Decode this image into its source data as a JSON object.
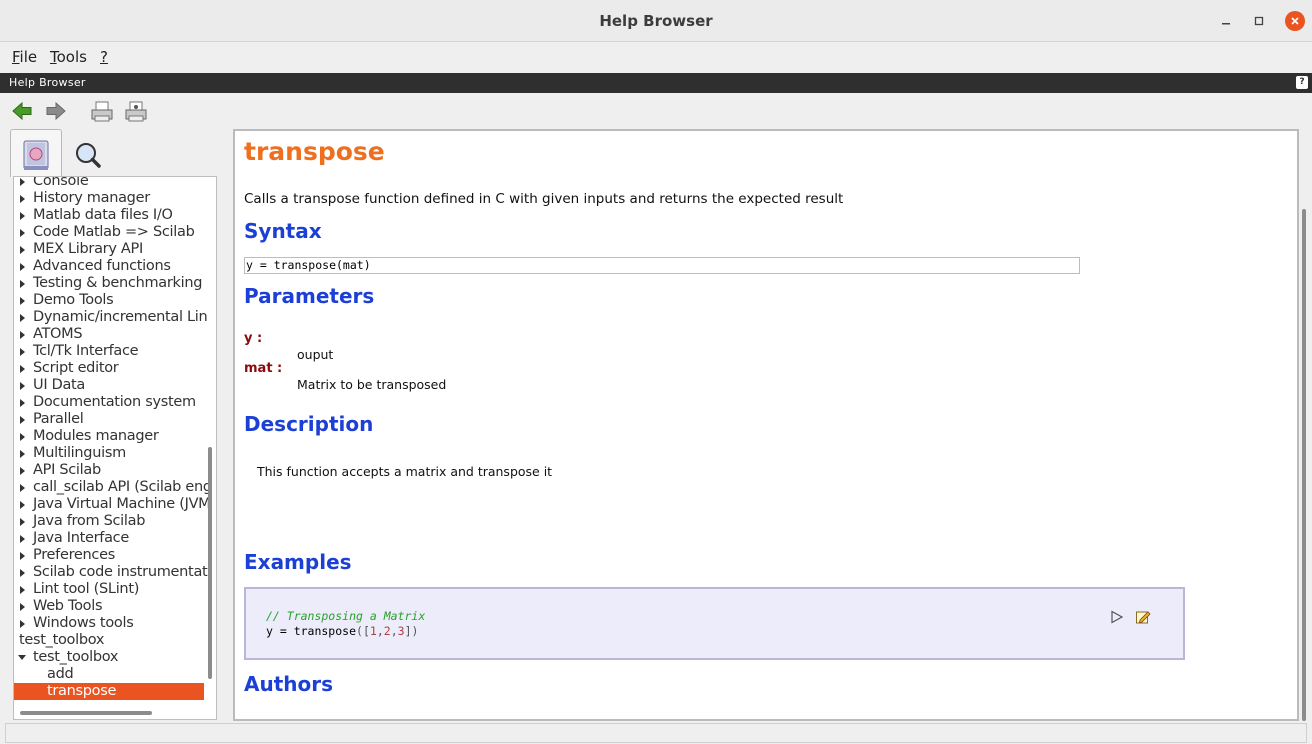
{
  "window": {
    "title": "Help Browser",
    "minimize_glyph": "▁",
    "maximize_glyph": "▫",
    "close_glyph": "✕"
  },
  "menu": [
    {
      "underline": "F",
      "rest": "ile"
    },
    {
      "underline": "T",
      "rest": "ools"
    },
    {
      "underline": "?",
      "rest": ""
    }
  ],
  "dock": {
    "title": "Help Browser",
    "help_glyph": "?"
  },
  "toolbar": {
    "icons": [
      "back-arrow-icon",
      "forward-arrow-icon",
      "print-icon",
      "page-setup-icon"
    ]
  },
  "tabs": [
    {
      "icon": "help-book-icon"
    },
    {
      "icon": "magnifier-icon"
    }
  ],
  "tree": {
    "items": [
      {
        "label": "Console",
        "level": 1,
        "expandable": true
      },
      {
        "label": "History manager",
        "level": 1,
        "expandable": true
      },
      {
        "label": "Matlab data files I/O",
        "level": 1,
        "expandable": true
      },
      {
        "label": "Code Matlab => Scilab",
        "level": 1,
        "expandable": true
      },
      {
        "label": "MEX Library API",
        "level": 1,
        "expandable": true
      },
      {
        "label": "Advanced functions",
        "level": 1,
        "expandable": true
      },
      {
        "label": "Testing & benchmarking",
        "level": 1,
        "expandable": true
      },
      {
        "label": "Demo Tools",
        "level": 1,
        "expandable": true
      },
      {
        "label": "Dynamic/incremental Lin",
        "level": 1,
        "expandable": true
      },
      {
        "label": "ATOMS",
        "level": 1,
        "expandable": true
      },
      {
        "label": "Tcl/Tk Interface",
        "level": 1,
        "expandable": true
      },
      {
        "label": "Script editor",
        "level": 1,
        "expandable": true
      },
      {
        "label": "UI Data",
        "level": 1,
        "expandable": true
      },
      {
        "label": "Documentation system",
        "level": 1,
        "expandable": true
      },
      {
        "label": "Parallel",
        "level": 1,
        "expandable": true
      },
      {
        "label": "Modules manager",
        "level": 1,
        "expandable": true
      },
      {
        "label": "Multilinguism",
        "level": 1,
        "expandable": true
      },
      {
        "label": "API Scilab",
        "level": 1,
        "expandable": true
      },
      {
        "label": "call_scilab API (Scilab eng",
        "level": 1,
        "expandable": true
      },
      {
        "label": "Java Virtual Machine (JVM",
        "level": 1,
        "expandable": true
      },
      {
        "label": "Java from Scilab",
        "level": 1,
        "expandable": true
      },
      {
        "label": "Java Interface",
        "level": 1,
        "expandable": true
      },
      {
        "label": "Preferences",
        "level": 1,
        "expandable": true
      },
      {
        "label": "Scilab code instrumentat",
        "level": 1,
        "expandable": true
      },
      {
        "label": "Lint tool (SLint)",
        "level": 1,
        "expandable": true
      },
      {
        "label": "Web Tools",
        "level": 1,
        "expandable": true
      },
      {
        "label": "Windows tools",
        "level": 1,
        "expandable": true
      },
      {
        "label": "test_toolbox",
        "level": 0,
        "expandable": false
      },
      {
        "label": "test_toolbox",
        "level": 1,
        "expandable": true,
        "expanded": true
      },
      {
        "label": "add",
        "level": 2,
        "expandable": false
      },
      {
        "label": "transpose",
        "level": 2,
        "expandable": false,
        "selected": true
      }
    ]
  },
  "content": {
    "title": "transpose",
    "purpose": "Calls a transpose function defined in C with given inputs and returns the expected result",
    "syntax_heading": "Syntax",
    "syntax": "y = transpose(mat)",
    "parameters_heading": "Parameters",
    "params": [
      {
        "term": "y :",
        "def": "ouput"
      },
      {
        "term": "mat :",
        "def": "Matrix to be transposed"
      }
    ],
    "description_heading": "Description",
    "description": "This function accepts a matrix and transpose it",
    "examples_heading": "Examples",
    "example_comment": "// Transposing a Matrix",
    "example_code_prefix": "y = transpose",
    "example_code_open": "([",
    "example_code_args": [
      "1",
      "2",
      "3"
    ],
    "example_code_close": "])",
    "authors_heading": "Authors"
  },
  "colors": {
    "accent": "#e95420",
    "title_orange": "#f06f1f",
    "heading_blue": "#1c3fd6",
    "term_red": "#8b0a0a",
    "example_bg": "#ececfb"
  }
}
